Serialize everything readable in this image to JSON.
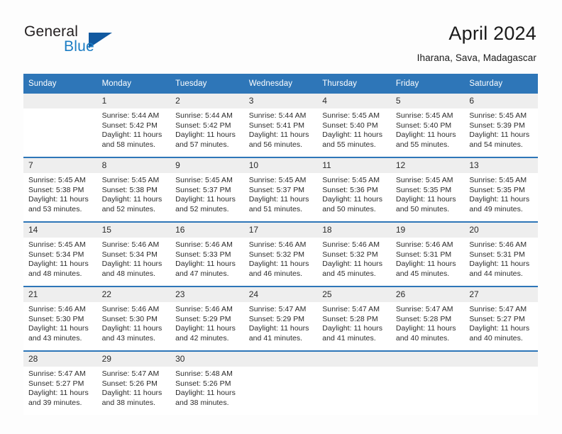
{
  "brand": {
    "name_part1": "General",
    "name_part2": "Blue",
    "triangle_icon": "triangle-icon",
    "accent_color": "#1159a0",
    "blue_text_color": "#1b7dc4"
  },
  "header": {
    "title": "April 2024",
    "location": "Iharana, Sava, Madagascar"
  },
  "calendar": {
    "header_bg": "#2e76b8",
    "daynum_bg": "#eeeeee",
    "weekday_headers": [
      "Sunday",
      "Monday",
      "Tuesday",
      "Wednesday",
      "Thursday",
      "Friday",
      "Saturday"
    ],
    "weeks": [
      {
        "days": [
          {
            "num": "",
            "sunrise": "",
            "sunset": "",
            "daylight_line1": "",
            "daylight_line2": ""
          },
          {
            "num": "1",
            "sunrise": "Sunrise: 5:44 AM",
            "sunset": "Sunset: 5:42 PM",
            "daylight_line1": "Daylight: 11 hours",
            "daylight_line2": "and 58 minutes."
          },
          {
            "num": "2",
            "sunrise": "Sunrise: 5:44 AM",
            "sunset": "Sunset: 5:42 PM",
            "daylight_line1": "Daylight: 11 hours",
            "daylight_line2": "and 57 minutes."
          },
          {
            "num": "3",
            "sunrise": "Sunrise: 5:44 AM",
            "sunset": "Sunset: 5:41 PM",
            "daylight_line1": "Daylight: 11 hours",
            "daylight_line2": "and 56 minutes."
          },
          {
            "num": "4",
            "sunrise": "Sunrise: 5:45 AM",
            "sunset": "Sunset: 5:40 PM",
            "daylight_line1": "Daylight: 11 hours",
            "daylight_line2": "and 55 minutes."
          },
          {
            "num": "5",
            "sunrise": "Sunrise: 5:45 AM",
            "sunset": "Sunset: 5:40 PM",
            "daylight_line1": "Daylight: 11 hours",
            "daylight_line2": "and 55 minutes."
          },
          {
            "num": "6",
            "sunrise": "Sunrise: 5:45 AM",
            "sunset": "Sunset: 5:39 PM",
            "daylight_line1": "Daylight: 11 hours",
            "daylight_line2": "and 54 minutes."
          }
        ]
      },
      {
        "days": [
          {
            "num": "7",
            "sunrise": "Sunrise: 5:45 AM",
            "sunset": "Sunset: 5:38 PM",
            "daylight_line1": "Daylight: 11 hours",
            "daylight_line2": "and 53 minutes."
          },
          {
            "num": "8",
            "sunrise": "Sunrise: 5:45 AM",
            "sunset": "Sunset: 5:38 PM",
            "daylight_line1": "Daylight: 11 hours",
            "daylight_line2": "and 52 minutes."
          },
          {
            "num": "9",
            "sunrise": "Sunrise: 5:45 AM",
            "sunset": "Sunset: 5:37 PM",
            "daylight_line1": "Daylight: 11 hours",
            "daylight_line2": "and 52 minutes."
          },
          {
            "num": "10",
            "sunrise": "Sunrise: 5:45 AM",
            "sunset": "Sunset: 5:37 PM",
            "daylight_line1": "Daylight: 11 hours",
            "daylight_line2": "and 51 minutes."
          },
          {
            "num": "11",
            "sunrise": "Sunrise: 5:45 AM",
            "sunset": "Sunset: 5:36 PM",
            "daylight_line1": "Daylight: 11 hours",
            "daylight_line2": "and 50 minutes."
          },
          {
            "num": "12",
            "sunrise": "Sunrise: 5:45 AM",
            "sunset": "Sunset: 5:35 PM",
            "daylight_line1": "Daylight: 11 hours",
            "daylight_line2": "and 50 minutes."
          },
          {
            "num": "13",
            "sunrise": "Sunrise: 5:45 AM",
            "sunset": "Sunset: 5:35 PM",
            "daylight_line1": "Daylight: 11 hours",
            "daylight_line2": "and 49 minutes."
          }
        ]
      },
      {
        "days": [
          {
            "num": "14",
            "sunrise": "Sunrise: 5:45 AM",
            "sunset": "Sunset: 5:34 PM",
            "daylight_line1": "Daylight: 11 hours",
            "daylight_line2": "and 48 minutes."
          },
          {
            "num": "15",
            "sunrise": "Sunrise: 5:46 AM",
            "sunset": "Sunset: 5:34 PM",
            "daylight_line1": "Daylight: 11 hours",
            "daylight_line2": "and 48 minutes."
          },
          {
            "num": "16",
            "sunrise": "Sunrise: 5:46 AM",
            "sunset": "Sunset: 5:33 PM",
            "daylight_line1": "Daylight: 11 hours",
            "daylight_line2": "and 47 minutes."
          },
          {
            "num": "17",
            "sunrise": "Sunrise: 5:46 AM",
            "sunset": "Sunset: 5:32 PM",
            "daylight_line1": "Daylight: 11 hours",
            "daylight_line2": "and 46 minutes."
          },
          {
            "num": "18",
            "sunrise": "Sunrise: 5:46 AM",
            "sunset": "Sunset: 5:32 PM",
            "daylight_line1": "Daylight: 11 hours",
            "daylight_line2": "and 45 minutes."
          },
          {
            "num": "19",
            "sunrise": "Sunrise: 5:46 AM",
            "sunset": "Sunset: 5:31 PM",
            "daylight_line1": "Daylight: 11 hours",
            "daylight_line2": "and 45 minutes."
          },
          {
            "num": "20",
            "sunrise": "Sunrise: 5:46 AM",
            "sunset": "Sunset: 5:31 PM",
            "daylight_line1": "Daylight: 11 hours",
            "daylight_line2": "and 44 minutes."
          }
        ]
      },
      {
        "days": [
          {
            "num": "21",
            "sunrise": "Sunrise: 5:46 AM",
            "sunset": "Sunset: 5:30 PM",
            "daylight_line1": "Daylight: 11 hours",
            "daylight_line2": "and 43 minutes."
          },
          {
            "num": "22",
            "sunrise": "Sunrise: 5:46 AM",
            "sunset": "Sunset: 5:30 PM",
            "daylight_line1": "Daylight: 11 hours",
            "daylight_line2": "and 43 minutes."
          },
          {
            "num": "23",
            "sunrise": "Sunrise: 5:46 AM",
            "sunset": "Sunset: 5:29 PM",
            "daylight_line1": "Daylight: 11 hours",
            "daylight_line2": "and 42 minutes."
          },
          {
            "num": "24",
            "sunrise": "Sunrise: 5:47 AM",
            "sunset": "Sunset: 5:29 PM",
            "daylight_line1": "Daylight: 11 hours",
            "daylight_line2": "and 41 minutes."
          },
          {
            "num": "25",
            "sunrise": "Sunrise: 5:47 AM",
            "sunset": "Sunset: 5:28 PM",
            "daylight_line1": "Daylight: 11 hours",
            "daylight_line2": "and 41 minutes."
          },
          {
            "num": "26",
            "sunrise": "Sunrise: 5:47 AM",
            "sunset": "Sunset: 5:28 PM",
            "daylight_line1": "Daylight: 11 hours",
            "daylight_line2": "and 40 minutes."
          },
          {
            "num": "27",
            "sunrise": "Sunrise: 5:47 AM",
            "sunset": "Sunset: 5:27 PM",
            "daylight_line1": "Daylight: 11 hours",
            "daylight_line2": "and 40 minutes."
          }
        ]
      },
      {
        "days": [
          {
            "num": "28",
            "sunrise": "Sunrise: 5:47 AM",
            "sunset": "Sunset: 5:27 PM",
            "daylight_line1": "Daylight: 11 hours",
            "daylight_line2": "and 39 minutes."
          },
          {
            "num": "29",
            "sunrise": "Sunrise: 5:47 AM",
            "sunset": "Sunset: 5:26 PM",
            "daylight_line1": "Daylight: 11 hours",
            "daylight_line2": "and 38 minutes."
          },
          {
            "num": "30",
            "sunrise": "Sunrise: 5:48 AM",
            "sunset": "Sunset: 5:26 PM",
            "daylight_line1": "Daylight: 11 hours",
            "daylight_line2": "and 38 minutes."
          },
          {
            "num": "",
            "sunrise": "",
            "sunset": "",
            "daylight_line1": "",
            "daylight_line2": ""
          },
          {
            "num": "",
            "sunrise": "",
            "sunset": "",
            "daylight_line1": "",
            "daylight_line2": ""
          },
          {
            "num": "",
            "sunrise": "",
            "sunset": "",
            "daylight_line1": "",
            "daylight_line2": ""
          },
          {
            "num": "",
            "sunrise": "",
            "sunset": "",
            "daylight_line1": "",
            "daylight_line2": ""
          }
        ]
      }
    ]
  }
}
